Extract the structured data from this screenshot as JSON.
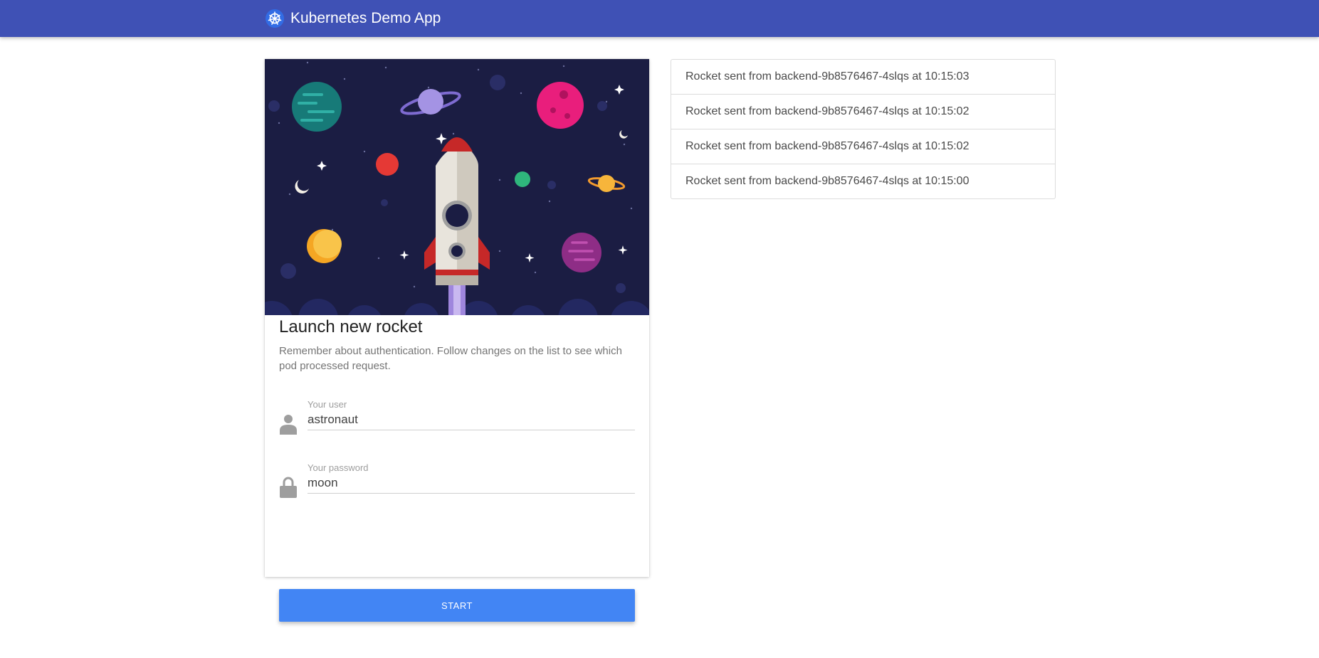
{
  "header": {
    "title": "Kubernetes Demo App",
    "logo_icon": "kubernetes-wheel-icon",
    "background": "#3f51b5"
  },
  "launch_card": {
    "image_icon": "rocket-space-illustration",
    "title": "Launch new rocket",
    "description": "Remember about authentication. Follow changes on the list to see which pod processed request.",
    "user_field": {
      "label": "Your user",
      "value": "astronaut",
      "icon": "person-icon"
    },
    "password_field": {
      "label": "Your password",
      "value": "moon",
      "icon": "lock-icon"
    },
    "start_label": "START",
    "accent": "#4285f4"
  },
  "rocket_log": {
    "items": [
      "Rocket sent from backend-9b8576467-4slqs at 10:15:03",
      "Rocket sent from backend-9b8576467-4slqs at 10:15:02",
      "Rocket sent from backend-9b8576467-4slqs at 10:15:02",
      "Rocket sent from backend-9b8576467-4slqs at 10:15:00"
    ]
  }
}
